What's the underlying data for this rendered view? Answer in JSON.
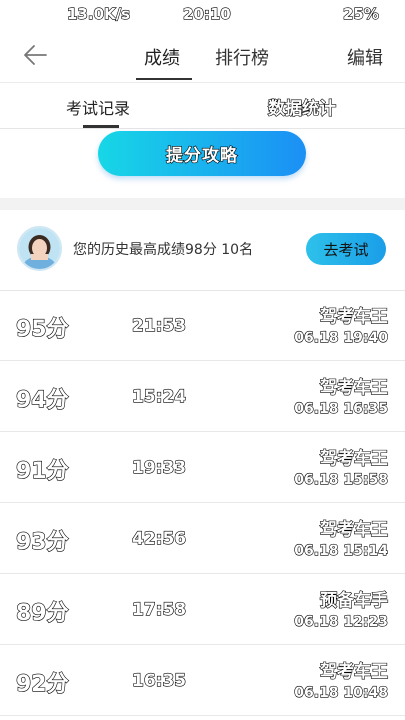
{
  "status": {
    "speed": "13.0K/s",
    "time": "20:10",
    "battery": "25%"
  },
  "header": {
    "tab_scores": "成绩",
    "tab_rank": "排行榜",
    "edit": "编辑"
  },
  "subtabs": {
    "records": "考试记录",
    "stats": "数据统计"
  },
  "tip_button": "提分攻略",
  "best": {
    "text": "您的历史最高成绩98分  10名",
    "exam_button": "去考试"
  },
  "records": [
    {
      "score": "95分",
      "duration": "21:53",
      "title": "驾考车王",
      "date": "06.18  19:40"
    },
    {
      "score": "94分",
      "duration": "15:24",
      "title": "驾考车王",
      "date": "06.18  16:35"
    },
    {
      "score": "91分",
      "duration": "19:33",
      "title": "驾考车王",
      "date": "06.18  15:58"
    },
    {
      "score": "93分",
      "duration": "42:56",
      "title": "驾考车王",
      "date": "06.18  15:14"
    },
    {
      "score": "89分",
      "duration": "17:58",
      "title": "预备车手",
      "date": "06.18  12:23"
    },
    {
      "score": "92分",
      "duration": "16:35",
      "title": "驾考车王",
      "date": "06.18  10:48"
    }
  ]
}
